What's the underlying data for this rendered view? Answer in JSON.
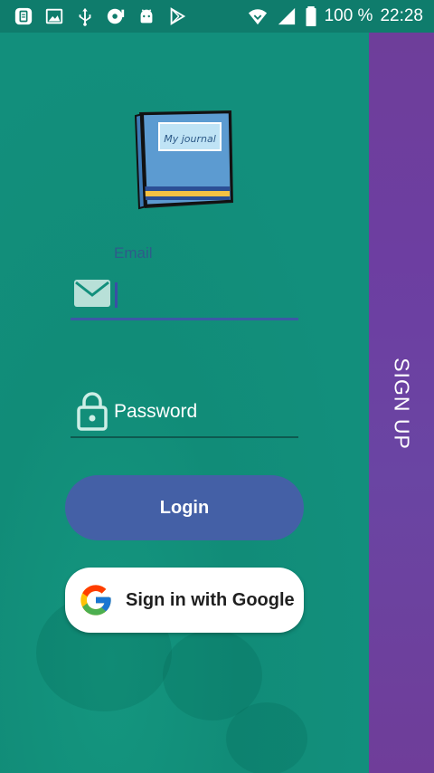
{
  "status_bar": {
    "battery_percent": "100 %",
    "time": "22:28",
    "icons": [
      "clipboard-icon",
      "image-icon",
      "usb-icon",
      "music-disc-icon",
      "android-icon",
      "play-store-icon",
      "wifi-icon",
      "signal-icon",
      "battery-icon"
    ]
  },
  "login": {
    "email_label": "Email",
    "password_placeholder": "Password",
    "login_button": "Login",
    "google_button": "Sign in with Google"
  },
  "logo": {
    "text": "My journal"
  },
  "side_panel": {
    "signup_label": "SIGN UP"
  },
  "colors": {
    "background": "#128f7c",
    "status_bar": "#0f7c6c",
    "accent_blue": "#4460a6",
    "signup_purple": "#6e3e9a"
  }
}
